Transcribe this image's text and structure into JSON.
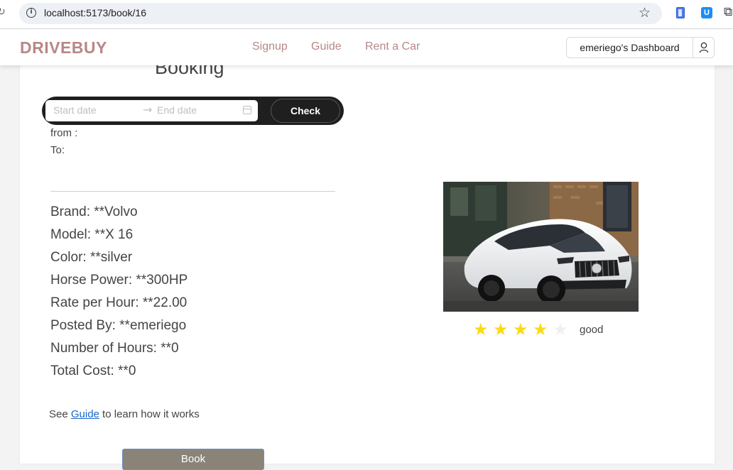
{
  "browser": {
    "url": "localhost:5173/book/16"
  },
  "header": {
    "logo": "DRIVEBUY",
    "nav": [
      "Signup",
      "Guide",
      "Rent a Car"
    ],
    "dashboard_label": "emeriego's Dashboard"
  },
  "booking": {
    "title": "Booking",
    "start_placeholder": "Start date",
    "end_placeholder": "End date",
    "check_label": "Check",
    "from_label": "from :",
    "to_label": "To:"
  },
  "details": [
    "Brand: **Volvo",
    "Model: **X 16",
    "Color: **silver",
    "Horse Power: **300HP",
    "Rate per Hour: **22.00",
    "Posted By: **emeriego",
    "Number of Hours: **0",
    "Total Cost: **0"
  ],
  "rating": {
    "value": 4,
    "max": 5,
    "label": "good",
    "star_color": "#fadb14",
    "empty_color": "#f0f0f0"
  },
  "guide_hint": {
    "prefix": "See ",
    "link": "Guide",
    "suffix": " to learn how it works"
  },
  "book_label": "Book",
  "colors": {
    "brand": "#b98787",
    "link": "#1a66c9"
  }
}
